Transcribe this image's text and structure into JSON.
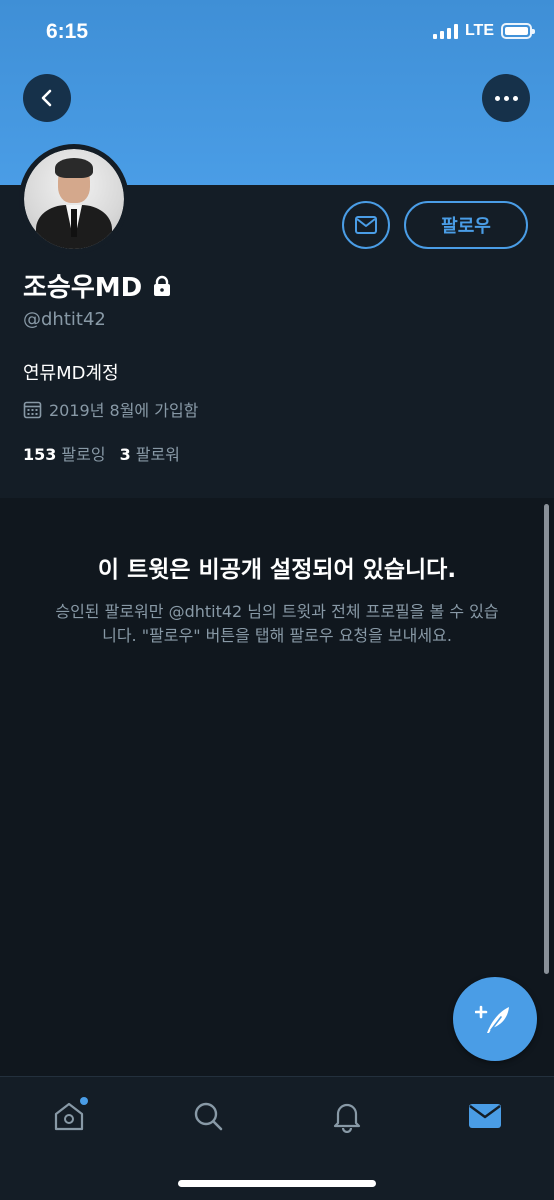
{
  "status_bar": {
    "time": "6:15",
    "network": "LTE"
  },
  "header": {
    "back_icon": "chevron-left-icon",
    "more_icon": "more-horizontal-icon",
    "banner_color": "#4a9de6"
  },
  "profile": {
    "name": "조승우MD",
    "protected_icon": "lock-icon",
    "handle": "@dhtit42",
    "bio": "연뮤MD계정",
    "joined": "2019년 8월에 가입함",
    "message_icon": "envelope-icon",
    "follow_label": "팔로우",
    "following_count": "153",
    "following_label": "팔로잉",
    "followers_count": "3",
    "followers_label": "팔로워"
  },
  "protected_notice": {
    "title": "이 트윗은 비공개 설정되어 있습니다.",
    "body": "승인된 팔로워만 @dhtit42 님의 트윗과 전체 프로필을 볼 수 있습니다. \"팔로우\" 버튼을 탭해 팔로우 요청을 보내세요."
  },
  "compose": {
    "icon": "compose-tweet-icon"
  },
  "tabbar": {
    "items": [
      {
        "name": "home",
        "icon": "home-icon"
      },
      {
        "name": "search",
        "icon": "search-icon"
      },
      {
        "name": "notifications",
        "icon": "bell-icon"
      },
      {
        "name": "messages",
        "icon": "envelope-icon",
        "active": true
      }
    ]
  },
  "colors": {
    "accent": "#4a9de6",
    "background": "#141d26",
    "secondary_text": "#8899a6"
  }
}
